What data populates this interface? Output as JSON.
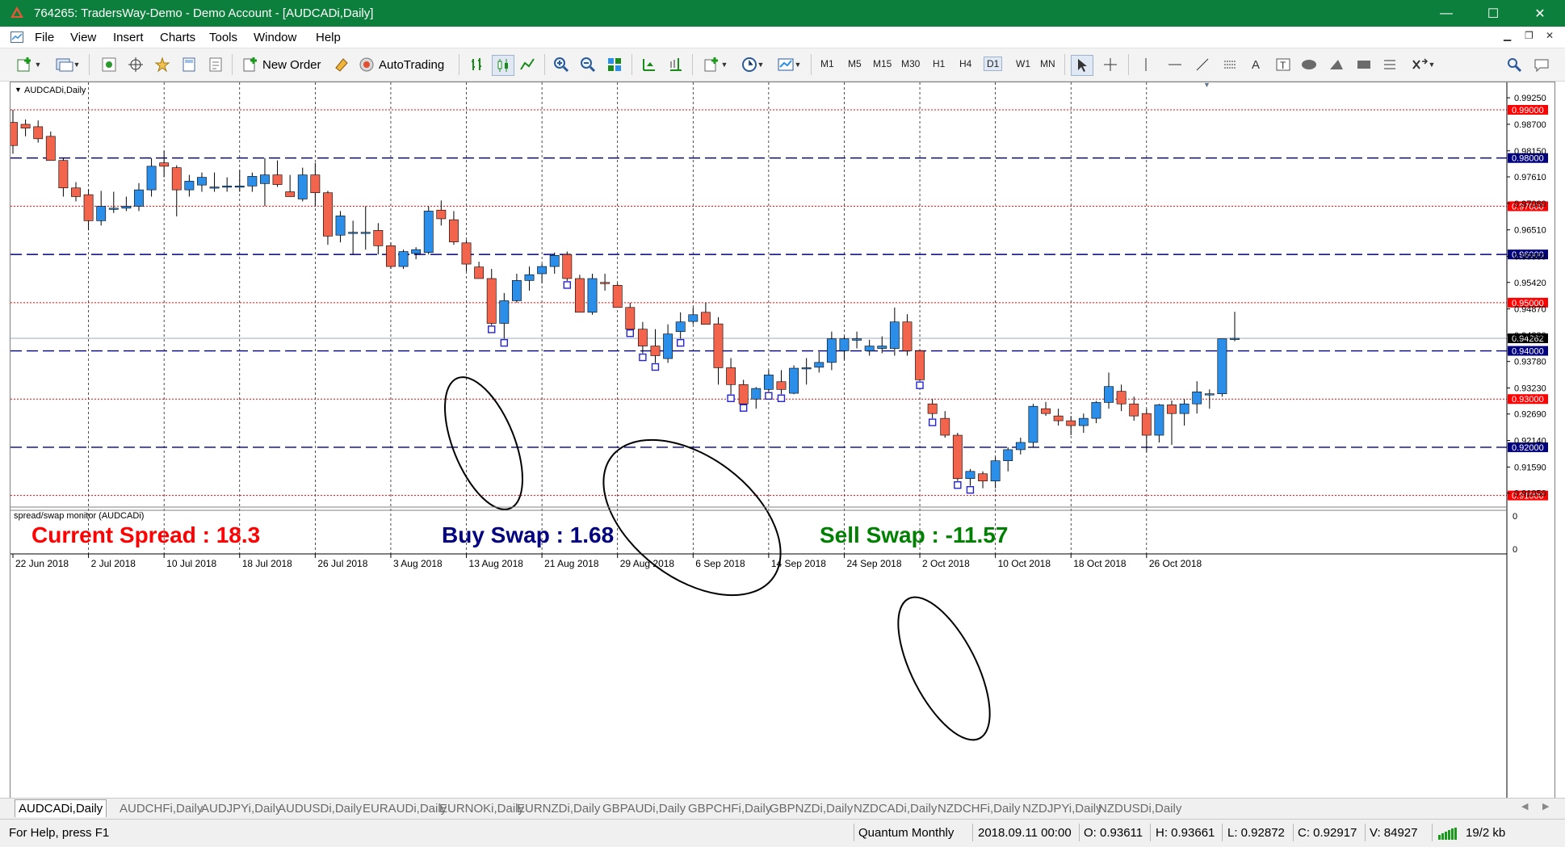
{
  "window": {
    "title": "764265: TradersWay-Demo - Demo Account - [AUDCADi,Daily]",
    "minimize": "—",
    "maximize": "☐",
    "close": "✕"
  },
  "menu": [
    "File",
    "View",
    "Insert",
    "Charts",
    "Tools",
    "Window",
    "Help"
  ],
  "toolbar": {
    "new_order": "New Order",
    "autotrading": "AutoTrading",
    "timeframes": [
      "M1",
      "M5",
      "M15",
      "M30",
      "H1",
      "H4",
      "D1",
      "W1",
      "MN"
    ],
    "active_timeframe": "D1"
  },
  "chart": {
    "symbol_label": "AUDCADi,Daily",
    "price_ticks": [
      "0.99250",
      "0.98700",
      "0.98150",
      "0.97610",
      "0.97060",
      "0.96510",
      "0.95960",
      "0.95420",
      "0.94870",
      "0.94330",
      "0.93780",
      "0.93230",
      "0.92690",
      "0.92140",
      "0.91590",
      "0.91050"
    ],
    "level_lines": [
      {
        "label": "0.99000",
        "color": "#ff0000"
      },
      {
        "label": "0.98000",
        "color": "#000080"
      },
      {
        "label": "0.97000",
        "color": "#ff0000"
      },
      {
        "label": "0.96000",
        "color": "#000080"
      },
      {
        "label": "0.95000",
        "color": "#ff0000"
      },
      {
        "label": "0.94000",
        "color": "#000080"
      },
      {
        "label": "0.93000",
        "color": "#ff0000"
      },
      {
        "label": "0.92000",
        "color": "#000080"
      },
      {
        "label": "0.91000",
        "color": "#ff0000"
      }
    ],
    "current_price": "0.94262",
    "date_labels": [
      "22 Jun 2018",
      "2 Jul 2018",
      "10 Jul 2018",
      "18 Jul 2018",
      "26 Jul 2018",
      "3 Aug 2018",
      "13 Aug 2018",
      "21 Aug 2018",
      "29 Aug 2018",
      "6 Sep 2018",
      "14 Sep 2018",
      "24 Sep 2018",
      "2 Oct 2018",
      "10 Oct 2018",
      "18 Oct 2018",
      "26 Oct 2018"
    ],
    "bull_color": "#2b8ee8",
    "bear_color": "#f2644c"
  },
  "indicator": {
    "label": "spread/swap monitor (AUDCADi)",
    "current_spread": "Current Spread : 18.3",
    "buy_swap": "Buy Swap : 1.68",
    "sell_swap": "Sell Swap : -11.57",
    "scale_top": "0",
    "scale_bottom": "0",
    "spread_color": "#ff0000",
    "buy_color": "#000080",
    "sell_color": "#008000"
  },
  "tabs": [
    "AUDCADi,Daily",
    "AUDCHFi,Daily",
    "AUDJPYi,Daily",
    "AUDUSDi,Daily",
    "EURAUDi,Daily",
    "EURNOKi,Daily",
    "EURNZDi,Daily",
    "GBPAUDi,Daily",
    "GBPCHFi,Daily",
    "GBPNZDi,Daily",
    "NZDCADi,Daily",
    "NZDCHFi,Daily",
    "NZDJPYi,Daily",
    "NZDUSDi,Daily"
  ],
  "status": {
    "help": "For Help, press F1",
    "profile": "Quantum Monthly",
    "datetime": "2018.09.11 00:00",
    "open": "O: 0.93611",
    "high": "H: 0.93661",
    "low": "L: 0.92872",
    "close": "C: 0.92917",
    "volume": "V: 84927",
    "traffic": "19/2 kb"
  },
  "chart_data": {
    "type": "candlestick",
    "symbol": "AUDCADi",
    "timeframe": "Daily",
    "ylim": [
      0.9086,
      0.9957
    ],
    "candles": [
      [
        0.9874,
        0.99,
        0.9809,
        0.9826
      ],
      [
        0.987,
        0.988,
        0.9845,
        0.9862
      ],
      [
        0.9865,
        0.9878,
        0.9832,
        0.984
      ],
      [
        0.9845,
        0.9855,
        0.9795,
        0.9795
      ],
      [
        0.9795,
        0.98,
        0.972,
        0.9738
      ],
      [
        0.9738,
        0.975,
        0.971,
        0.972
      ],
      [
        0.9724,
        0.9735,
        0.965,
        0.967
      ],
      [
        0.967,
        0.9732,
        0.966,
        0.97
      ],
      [
        0.9696,
        0.973,
        0.9686,
        0.9696
      ],
      [
        0.9696,
        0.972,
        0.969,
        0.97
      ],
      [
        0.97,
        0.9748,
        0.969,
        0.9734
      ],
      [
        0.9734,
        0.98,
        0.972,
        0.9783
      ],
      [
        0.979,
        0.9815,
        0.976,
        0.9783
      ],
      [
        0.978,
        0.9785,
        0.9679,
        0.9734
      ],
      [
        0.9734,
        0.9765,
        0.972,
        0.9752
      ],
      [
        0.9744,
        0.977,
        0.973,
        0.976
      ],
      [
        0.974,
        0.977,
        0.973,
        0.974
      ],
      [
        0.9742,
        0.976,
        0.973,
        0.9742
      ],
      [
        0.9742,
        0.9775,
        0.973,
        0.9742
      ],
      [
        0.9742,
        0.977,
        0.973,
        0.9762
      ],
      [
        0.9747,
        0.98,
        0.97,
        0.9765
      ],
      [
        0.9765,
        0.9795,
        0.974,
        0.9745
      ],
      [
        0.973,
        0.9765,
        0.972,
        0.972
      ],
      [
        0.9715,
        0.978,
        0.971,
        0.9765
      ],
      [
        0.9765,
        0.979,
        0.97,
        0.9728
      ],
      [
        0.9728,
        0.9732,
        0.962,
        0.9638
      ],
      [
        0.964,
        0.969,
        0.9625,
        0.968
      ],
      [
        0.9646,
        0.967,
        0.96,
        0.9646
      ],
      [
        0.9646,
        0.97,
        0.961,
        0.9646
      ],
      [
        0.965,
        0.9665,
        0.96,
        0.9618
      ],
      [
        0.9618,
        0.9625,
        0.957,
        0.9575
      ],
      [
        0.9575,
        0.961,
        0.957,
        0.9606
      ],
      [
        0.9602,
        0.9615,
        0.959,
        0.961
      ],
      [
        0.9604,
        0.97,
        0.96,
        0.969
      ],
      [
        0.9692,
        0.9712,
        0.966,
        0.9674
      ],
      [
        0.9672,
        0.969,
        0.962,
        0.9626
      ],
      [
        0.9624,
        0.963,
        0.9565,
        0.958
      ],
      [
        0.9574,
        0.9585,
        0.955,
        0.955
      ],
      [
        0.955,
        0.957,
        0.9453,
        0.9457
      ],
      [
        0.9457,
        0.952,
        0.9425,
        0.9504
      ],
      [
        0.9504,
        0.956,
        0.95,
        0.9546
      ],
      [
        0.9546,
        0.9575,
        0.9525,
        0.9558
      ],
      [
        0.956,
        0.958,
        0.954,
        0.9575
      ],
      [
        0.9575,
        0.9604,
        0.956,
        0.9598
      ],
      [
        0.96,
        0.9606,
        0.9545,
        0.955
      ],
      [
        0.955,
        0.9558,
        0.948,
        0.948
      ],
      [
        0.948,
        0.956,
        0.9475,
        0.955
      ],
      [
        0.9542,
        0.956,
        0.9525,
        0.954
      ],
      [
        0.9536,
        0.954,
        0.949,
        0.949
      ],
      [
        0.949,
        0.95,
        0.9445,
        0.9445
      ],
      [
        0.9445,
        0.946,
        0.9395,
        0.941
      ],
      [
        0.941,
        0.9445,
        0.9375,
        0.939
      ],
      [
        0.9384,
        0.9455,
        0.9375,
        0.9435
      ],
      [
        0.944,
        0.948,
        0.9425,
        0.946
      ],
      [
        0.9461,
        0.949,
        0.9455,
        0.9475
      ],
      [
        0.948,
        0.95,
        0.9455,
        0.9455
      ],
      [
        0.9456,
        0.947,
        0.933,
        0.9365
      ],
      [
        0.9365,
        0.9385,
        0.931,
        0.933
      ],
      [
        0.933,
        0.934,
        0.929,
        0.929
      ],
      [
        0.93,
        0.9325,
        0.928,
        0.9322
      ],
      [
        0.932,
        0.936,
        0.9315,
        0.935
      ],
      [
        0.9336,
        0.936,
        0.931,
        0.932
      ],
      [
        0.9312,
        0.937,
        0.931,
        0.9364
      ],
      [
        0.9364,
        0.9385,
        0.933,
        0.9365
      ],
      [
        0.9366,
        0.9398,
        0.9355,
        0.9376
      ],
      [
        0.9376,
        0.944,
        0.936,
        0.9425
      ],
      [
        0.94,
        0.943,
        0.9382,
        0.9425
      ],
      [
        0.9422,
        0.944,
        0.9405,
        0.9425
      ],
      [
        0.94,
        0.9423,
        0.939,
        0.941
      ],
      [
        0.9405,
        0.943,
        0.9395,
        0.941
      ],
      [
        0.9405,
        0.949,
        0.939,
        0.946
      ],
      [
        0.946,
        0.9476,
        0.939,
        0.94
      ],
      [
        0.94,
        0.9402,
        0.9337,
        0.934
      ],
      [
        0.929,
        0.93,
        0.926,
        0.927
      ],
      [
        0.926,
        0.9275,
        0.922,
        0.9225
      ],
      [
        0.9225,
        0.923,
        0.913,
        0.9135
      ],
      [
        0.9135,
        0.9155,
        0.912,
        0.915
      ],
      [
        0.9145,
        0.915,
        0.9115,
        0.913
      ],
      [
        0.913,
        0.918,
        0.9115,
        0.9172
      ],
      [
        0.9172,
        0.92,
        0.915,
        0.9195
      ],
      [
        0.9195,
        0.922,
        0.9185,
        0.921
      ],
      [
        0.921,
        0.929,
        0.92,
        0.9285
      ],
      [
        0.928,
        0.9294,
        0.9265,
        0.927
      ],
      [
        0.9265,
        0.928,
        0.9245,
        0.9255
      ],
      [
        0.9255,
        0.9265,
        0.9225,
        0.9245
      ],
      [
        0.9245,
        0.927,
        0.923,
        0.926
      ],
      [
        0.926,
        0.9296,
        0.925,
        0.9293
      ],
      [
        0.9293,
        0.9355,
        0.928,
        0.9326
      ],
      [
        0.9316,
        0.933,
        0.9275,
        0.929
      ],
      [
        0.929,
        0.9305,
        0.9255,
        0.9265
      ],
      [
        0.927,
        0.928,
        0.919,
        0.9225
      ],
      [
        0.9225,
        0.929,
        0.921,
        0.9288
      ],
      [
        0.9288,
        0.9297,
        0.9205,
        0.927
      ],
      [
        0.927,
        0.93,
        0.9245,
        0.929
      ],
      [
        0.929,
        0.9337,
        0.927,
        0.9315
      ],
      [
        0.9311,
        0.932,
        0.928,
        0.9311
      ],
      [
        0.9311,
        0.9425,
        0.9305,
        0.9425
      ],
      [
        0.9425,
        0.9481,
        0.942,
        0.9426
      ]
    ],
    "dates": [
      "22 Jun 2018",
      "2 Jul 2018",
      "10 Jul 2018",
      "18 Jul 2018",
      "26 Jul 2018",
      "3 Aug 2018",
      "13 Aug 2018",
      "21 Aug 2018",
      "29 Aug 2018",
      "6 Sep 2018",
      "14 Sep 2018",
      "24 Sep 2018",
      "2 Oct 2018",
      "10 Oct 2018",
      "18 Oct 2018",
      "26 Oct 2018"
    ],
    "horizontal_levels": [
      0.99,
      0.98,
      0.97,
      0.96,
      0.95,
      0.94,
      0.93,
      0.92,
      0.91
    ]
  }
}
